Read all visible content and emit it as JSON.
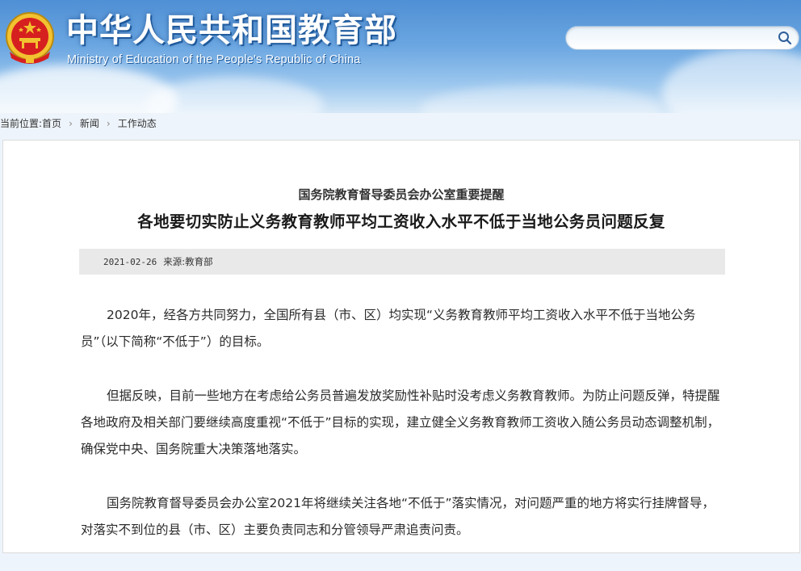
{
  "header": {
    "site_title_cn": "中华人民共和国教育部",
    "site_title_en": "Ministry of Education of the People's Republic of China",
    "emblem_icon": "national-emblem-icon"
  },
  "search": {
    "value": "",
    "placeholder": "",
    "icon": "search-icon"
  },
  "breadcrumb": {
    "label": "当前位置:",
    "items": [
      "首页",
      "新闻",
      "工作动态"
    ],
    "separator_icon": "chevron-right-icon"
  },
  "article": {
    "supertitle": "国务院教育督导委员会办公室重要提醒",
    "title": "各地要切实防止义务教育教师平均工资收入水平不低于当地公务员问题反复",
    "date": "2021-02-26",
    "source": "来源:教育部",
    "paragraphs": [
      "2020年，经各方共同努力，全国所有县（市、区）均实现“义务教育教师平均工资收入水平不低于当地公务员”（以下简称“不低于”）的目标。",
      "但据反映，目前一些地方在考虑给公务员普遍发放奖励性补贴时没考虑义务教育教师。为防止问题反弹，特提醒各地政府及相关部门要继续高度重视“不低于”目标的实现，建立健全义务教育教师工资收入随公务员动态调整机制，确保党中央、国务院重大决策落地落实。",
      "国务院教育督导委员会办公室2021年将继续关注各地“不低于”落实情况，对问题严重的地方将实行挂牌督导，对落实不到位的县（市、区）主要负责同志和分管领导严肃追责问责。"
    ]
  },
  "colors": {
    "header_top": "#4f8fd4",
    "header_bottom": "#d6e8f7",
    "emblem_red": "#d61f1f",
    "emblem_gold": "#f2c230",
    "meta_bar": "#e9e9e9"
  }
}
